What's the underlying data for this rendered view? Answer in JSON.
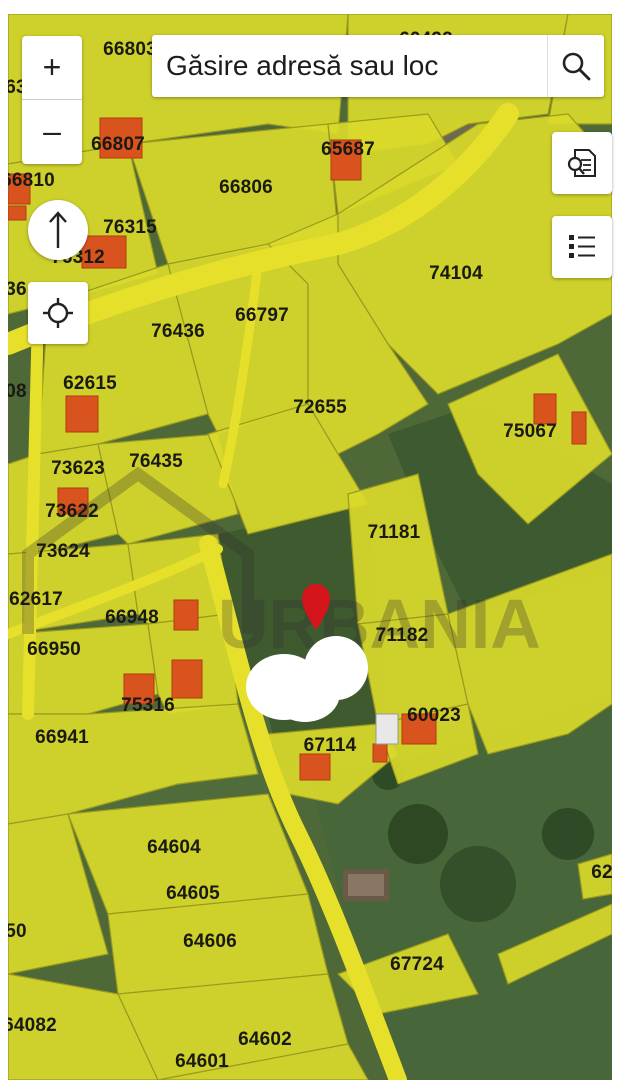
{
  "search": {
    "placeholder": "Găsire adresă sau loc"
  },
  "controls": {
    "zoom_in": "+",
    "zoom_out": "–",
    "search_icon": "search-icon",
    "identify_icon": "identify-icon",
    "legend_icon": "legend-list-icon",
    "north_icon": "north-arrow-icon",
    "locate_icon": "locate-crosshair-icon"
  },
  "colors": {
    "parcel_fill": "#d9d92a",
    "parcel_border": "#9a9a1e",
    "building": "#d9531f",
    "road": "#e6e02a",
    "vegetation": "#3d5a2c",
    "marker": "#d4151c"
  },
  "watermark": "URBANIA",
  "parcels": [
    "66803",
    "60492",
    "66807",
    "65687",
    "66810",
    "66806",
    "76315",
    "76312",
    "74104",
    "76436",
    "66797",
    "62615",
    "72655",
    "75067",
    "73623",
    "76435",
    "73622",
    "71181",
    "73624",
    "62617",
    "66948",
    "71182",
    "66950",
    "75316",
    "60023",
    "66941",
    "67114",
    "64604",
    "64605",
    "64606",
    "67724",
    "64082",
    "64602",
    "64601",
    "62",
    "36",
    "08",
    "50",
    "63"
  ]
}
